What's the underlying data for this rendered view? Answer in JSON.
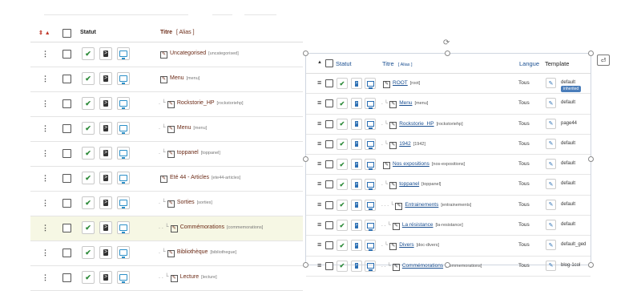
{
  "left_table": {
    "header": {
      "sort_label": "⇕ ▲",
      "status": "Statut",
      "title": "Titre",
      "alias": "[ Alias ]"
    },
    "rows": [
      {
        "indent": "",
        "title": "Uncategorised",
        "alias": "[uncategorised]",
        "highlight": false
      },
      {
        "indent": "",
        "title": "Menu",
        "alias": "[menu]",
        "highlight": false
      },
      {
        "indent": ". └",
        "title": "Rockstorie_HP",
        "alias": "[rockstoriehp]",
        "highlight": false
      },
      {
        "indent": ". └",
        "title": "Menu",
        "alias": "[menu]",
        "highlight": false
      },
      {
        "indent": ". └",
        "title": "toppanel",
        "alias": "[toppanel]",
        "highlight": false
      },
      {
        "indent": "",
        "title": "Eté 44 - Articles",
        "alias": "[ete44-articles]",
        "highlight": false
      },
      {
        "indent": ". └",
        "title": "Sorties",
        "alias": "[sorties]",
        "highlight": false
      },
      {
        "indent": ". . └",
        "title": "Commémorations",
        "alias": "[commemorations]",
        "highlight": true
      },
      {
        "indent": ". └",
        "title": "Bibliothèque",
        "alias": "[bibliothegue]",
        "highlight": false
      },
      {
        "indent": ". . └",
        "title": "Lecture",
        "alias": "[lecture]",
        "highlight": false
      }
    ]
  },
  "right_table": {
    "header": {
      "sort": "▲",
      "status": "Statut",
      "title": "Titre",
      "alias": "[ Alias ]",
      "language": "Langue",
      "template": "Template"
    },
    "rows": [
      {
        "indent": "",
        "title": "ROOT",
        "alias": "[root]",
        "lang": "Tous",
        "template": "default",
        "badge": "inherited"
      },
      {
        "indent": ". └",
        "title": "Menu",
        "alias": "[menu]",
        "lang": "Tous",
        "template": "default"
      },
      {
        "indent": ". └",
        "title": "Rockstorie_HP",
        "alias": "[rockstoriehp]",
        "lang": "Tous",
        "template": "page44"
      },
      {
        "indent": ". └",
        "title": "1942",
        "alias": "[1942]",
        "lang": "Tous",
        "template": "default"
      },
      {
        "indent": "",
        "title": "Nos expositions",
        "alias": "[nos-expositions]",
        "lang": "Tous",
        "template": "default"
      },
      {
        "indent": ". └",
        "title": "toppanel",
        "alias": "[toppanel]",
        "lang": "Tous",
        "template": "default"
      },
      {
        "indent": ". . . └",
        "title": "Entrainements",
        "alias": "[entrainements]",
        "lang": "Tous",
        "template": "default"
      },
      {
        "indent": ". . └",
        "title": "La résistance",
        "alias": "[la-resistance]",
        "lang": "Tous",
        "template": "default"
      },
      {
        "indent": ". └",
        "title": "Divers",
        "alias": "[doc-divers]",
        "lang": "Tous",
        "template": "default_ged"
      },
      {
        "indent": ". . └",
        "title": "Commémorations",
        "alias": "[commemorations]",
        "lang": "Tous",
        "template": "blog-1col"
      }
    ]
  },
  "colors": {
    "link": "#1a4f91",
    "title_dark": "#6b2a16",
    "published": "#2e8b3a",
    "highlight_row": "#f6f7e4"
  },
  "icons": [
    "kebab-icon",
    "checkbox-icon",
    "checkmark-icon",
    "feed-icon",
    "screen-icon",
    "edit-icon",
    "hamburger-icon",
    "rotate-icon",
    "return-icon"
  ]
}
